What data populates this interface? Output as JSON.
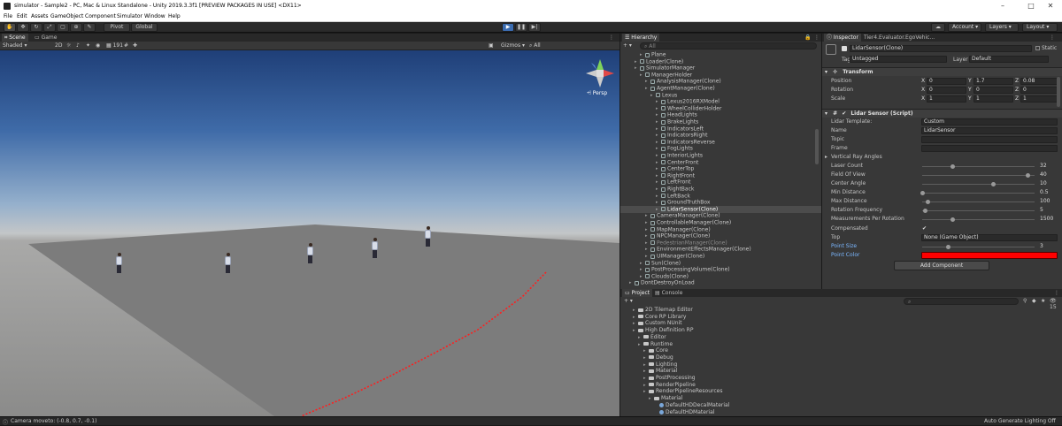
{
  "window": {
    "title": "simulator - Sample2 - PC, Mac & Linux Standalone - Unity 2019.3.3f1 [PREVIEW PACKAGES IN USE] <DX11>"
  },
  "menu": [
    "File",
    "Edit",
    "Assets",
    "GameObject",
    "Component",
    "Simulator",
    "Window",
    "Help"
  ],
  "toolbar": {
    "pivot": "Pivot",
    "global": "Global",
    "account": "Account",
    "layers": "Layers",
    "layout": "Layout"
  },
  "scene": {
    "tab_scene": "Scene",
    "tab_game": "Game",
    "shading": "Shaded",
    "mode_2d": "2D",
    "gizmos": "Gizmos",
    "search": "All",
    "persp": "Persp"
  },
  "hierarchy": {
    "title": "Hierarchy",
    "search": "All",
    "rows": [
      {
        "label": "Plane",
        "depth": 3,
        "sel": false,
        "dim": false
      },
      {
        "label": "Loader(Clone)",
        "depth": 2,
        "sel": false,
        "dim": false
      },
      {
        "label": "SimulatorManager",
        "depth": 2,
        "sel": false,
        "dim": false
      },
      {
        "label": "ManagerHolder",
        "depth": 3,
        "sel": false,
        "dim": false
      },
      {
        "label": "AnalysisManager(Clone)",
        "depth": 4,
        "sel": false,
        "dim": false
      },
      {
        "label": "AgentManager(Clone)",
        "depth": 4,
        "sel": false,
        "dim": false
      },
      {
        "label": "Lexus",
        "depth": 5,
        "sel": false,
        "dim": false
      },
      {
        "label": "Lexus2016RXModel",
        "depth": 6,
        "sel": false,
        "dim": false
      },
      {
        "label": "WheelColliderHolder",
        "depth": 6,
        "sel": false,
        "dim": false
      },
      {
        "label": "HeadLights",
        "depth": 6,
        "sel": false,
        "dim": false
      },
      {
        "label": "BrakeLights",
        "depth": 6,
        "sel": false,
        "dim": false
      },
      {
        "label": "IndicatorsLeft",
        "depth": 6,
        "sel": false,
        "dim": false
      },
      {
        "label": "IndicatorsRight",
        "depth": 6,
        "sel": false,
        "dim": false
      },
      {
        "label": "IndicatorsReverse",
        "depth": 6,
        "sel": false,
        "dim": false
      },
      {
        "label": "FogLights",
        "depth": 6,
        "sel": false,
        "dim": false
      },
      {
        "label": "InteriorLights",
        "depth": 6,
        "sel": false,
        "dim": false
      },
      {
        "label": "CenterFront",
        "depth": 6,
        "sel": false,
        "dim": false
      },
      {
        "label": "CenterTop",
        "depth": 6,
        "sel": false,
        "dim": false
      },
      {
        "label": "RightFront",
        "depth": 6,
        "sel": false,
        "dim": false
      },
      {
        "label": "LeftFront",
        "depth": 6,
        "sel": false,
        "dim": false
      },
      {
        "label": "RightBack",
        "depth": 6,
        "sel": false,
        "dim": false
      },
      {
        "label": "LeftBack",
        "depth": 6,
        "sel": false,
        "dim": false
      },
      {
        "label": "GroundTruthBox",
        "depth": 6,
        "sel": false,
        "dim": false
      },
      {
        "label": "LidarSensor(Clone)",
        "depth": 6,
        "sel": true,
        "dim": false
      },
      {
        "label": "CameraManager(Clone)",
        "depth": 4,
        "sel": false,
        "dim": false
      },
      {
        "label": "ControllableManager(Clone)",
        "depth": 4,
        "sel": false,
        "dim": false
      },
      {
        "label": "MapManager(Clone)",
        "depth": 4,
        "sel": false,
        "dim": false
      },
      {
        "label": "NPCManager(Clone)",
        "depth": 4,
        "sel": false,
        "dim": false
      },
      {
        "label": "PedestrianManager(Clone)",
        "depth": 4,
        "sel": false,
        "dim": true
      },
      {
        "label": "EnvironmentEffectsManager(Clone)",
        "depth": 4,
        "sel": false,
        "dim": false
      },
      {
        "label": "UIManager(Clone)",
        "depth": 4,
        "sel": false,
        "dim": false
      },
      {
        "label": "Sun(Clone)",
        "depth": 3,
        "sel": false,
        "dim": false
      },
      {
        "label": "PostProcessingVolume(Clone)",
        "depth": 3,
        "sel": false,
        "dim": false
      },
      {
        "label": "Clouds(Clone)",
        "depth": 3,
        "sel": false,
        "dim": false
      },
      {
        "label": "DontDestroyOnLoad",
        "depth": 1,
        "sel": false,
        "dim": false
      }
    ]
  },
  "inspector": {
    "tab_inspector": "Inspector",
    "tab_other": "Tier4.Evaluator.EgoVehic...",
    "object_name": "LidarSensor(Clone)",
    "static": "Static",
    "tag_label": "Tag",
    "tag": "Untagged",
    "layer_label": "Layer",
    "layer": "Default",
    "transform_title": "Transform",
    "transform": [
      {
        "label": "Position",
        "x": "0",
        "y": "1.7",
        "z": "0.08"
      },
      {
        "label": "Rotation",
        "x": "0",
        "y": "0",
        "z": "0"
      },
      {
        "label": "Scale",
        "x": "1",
        "y": "1",
        "z": "1"
      }
    ],
    "xyz": [
      "X",
      "Y",
      "Z"
    ],
    "lidar_title": "Lidar Sensor (Script)",
    "template_label": "Lidar Template:",
    "template_value": "Custom",
    "name_label": "Name",
    "name_value": "LidarSensor",
    "topic_label": "Topic",
    "frame_label": "Frame",
    "vra_label": "Vertical Ray Angles",
    "sliders": [
      {
        "label": "Laser Count",
        "value": "32",
        "frac": 0.27
      },
      {
        "label": "Field Of View",
        "value": "40",
        "frac": 0.94
      },
      {
        "label": "Center Angle",
        "value": "10",
        "frac": 0.63
      },
      {
        "label": "Min Distance",
        "value": "0.5",
        "frac": 0.0
      },
      {
        "label": "Max Distance",
        "value": "100",
        "frac": 0.05
      },
      {
        "label": "Rotation Frequency",
        "value": "5",
        "frac": 0.02
      },
      {
        "label": "Measurements Per Rotation",
        "value": "1500",
        "frac": 0.27
      }
    ],
    "compensated_label": "Compensated",
    "top_label": "Top",
    "top_value": "None (Game Object)",
    "point_size_label": "Point Size",
    "point_size_value": "3",
    "point_size_frac": 0.23,
    "point_color_label": "Point Color",
    "point_color": "#ff0000",
    "add_component": "Add Component"
  },
  "project": {
    "tab_project": "Project",
    "tab_console": "Console",
    "count": "15",
    "items": [
      {
        "label": "2D Tilemap Editor",
        "depth": 1,
        "type": "folder"
      },
      {
        "label": "Core RP Library",
        "depth": 1,
        "type": "folder"
      },
      {
        "label": "Custom NUnit",
        "depth": 1,
        "type": "folder"
      },
      {
        "label": "High Definition RP",
        "depth": 1,
        "type": "folder"
      },
      {
        "label": "Editor",
        "depth": 2,
        "type": "folder"
      },
      {
        "label": "Runtime",
        "depth": 2,
        "type": "folder"
      },
      {
        "label": "Core",
        "depth": 3,
        "type": "folder"
      },
      {
        "label": "Debug",
        "depth": 3,
        "type": "folder"
      },
      {
        "label": "Lighting",
        "depth": 3,
        "type": "folder"
      },
      {
        "label": "Material",
        "depth": 3,
        "type": "folder"
      },
      {
        "label": "PostProcessing",
        "depth": 3,
        "type": "folder"
      },
      {
        "label": "RenderPipeline",
        "depth": 3,
        "type": "folder"
      },
      {
        "label": "RenderPipelineResources",
        "depth": 3,
        "type": "folder"
      },
      {
        "label": "Material",
        "depth": 4,
        "type": "folder"
      },
      {
        "label": "DefaultHDDecalMaterial",
        "depth": 5,
        "type": "material"
      },
      {
        "label": "DefaultHDMaterial",
        "depth": 5,
        "type": "material"
      }
    ]
  },
  "status": {
    "left": "Camera moveto: (-0.8, 0.7, -0.1)",
    "right": "Auto Generate Lighting Off"
  }
}
